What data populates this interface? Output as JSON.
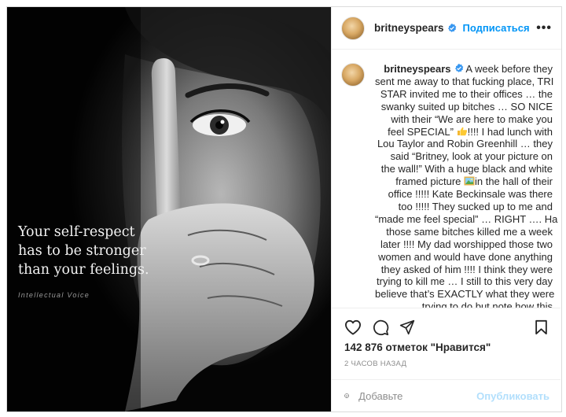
{
  "post": {
    "username": "britneyspears",
    "follow_label": "Подписаться",
    "more_label": "•••",
    "image": {
      "quote_lines": [
        "Your self-respect",
        "has to be stronger",
        "than your feelings."
      ],
      "brand": "Intellectual Voice"
    },
    "caption": {
      "username": "britneyspears",
      "lines": [
        " A week before they",
        "sent me away to that fucking place, TRI",
        "STAR invited me to their offices … the",
        "swanky suited up bitches … SO NICE",
        "with their “We are here to make you",
        "feel SPECIAL”",
        "!!!! I had lunch with",
        "Lou Taylor and Robin Greenhill … they",
        "said “Britney, look at your picture on",
        "the wall!” With a huge black and white",
        "framed picture ",
        "in the hall of their",
        "office !!!!! Kate Beckinsale was there",
        "too !!!!! They sucked up to me and",
        "“made me feel special” … RIGHT …. Ha",
        "those same bitches killed me a week",
        "later !!!! My dad worshipped those two",
        "women and would have done anything",
        "they asked of him !!!! I think they were",
        "trying to kill me … I still to this very day",
        "believe that’s EXACTLY what they were",
        "trying to do but note how this"
      ],
      "emoji_icons": [
        "thumbs-up-icon",
        "framed-picture-icon"
      ]
    },
    "likes": "142 876 отметок \"Нравится\"",
    "time": "2 ЧАСОВ НАЗАД",
    "comment_placeholder": "Добавьте",
    "publish_label": "Опубликовать",
    "icons": [
      "heart-icon",
      "comment-icon",
      "share-icon",
      "bookmark-icon",
      "emoji-icon",
      "verified-icon"
    ],
    "colors": {
      "link_blue": "#0095f6",
      "publish_disabled": "#b2dffc",
      "verified": "#3897f0"
    }
  }
}
